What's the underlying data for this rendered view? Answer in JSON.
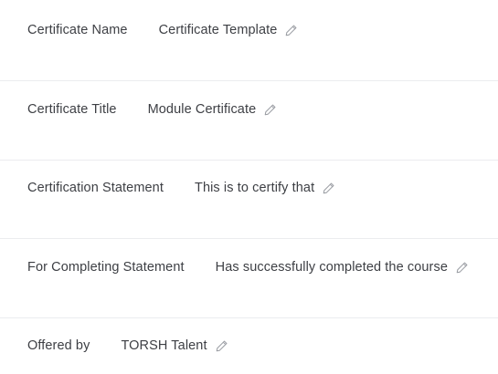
{
  "fields": [
    {
      "label": "Certificate Name",
      "value": "Certificate Template",
      "edit_icon": "pencil-icon"
    },
    {
      "label": "Certificate Title",
      "value": "Module Certificate",
      "edit_icon": "pencil-icon"
    },
    {
      "label": "Certification Statement",
      "value": "This is to certify that",
      "edit_icon": "pencil-icon"
    },
    {
      "label": "For Completing Statement",
      "value": "Has successfully completed the course",
      "edit_icon": "pencil-icon"
    },
    {
      "label": "Offered by",
      "value": "TORSH Talent",
      "edit_icon": "pencil-icon"
    }
  ],
  "colors": {
    "text": "#3d3f44",
    "icon": "#9a9da3",
    "divider": "#ebecef"
  }
}
